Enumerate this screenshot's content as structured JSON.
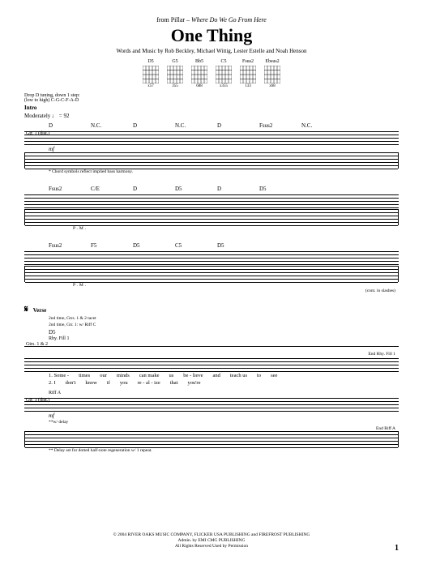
{
  "header": {
    "from_prefix": "from Pillar – ",
    "album": "Where Do We Go From Here",
    "title": "One Thing",
    "credits": "Words and Music by Rob Beckley, Michael Wittig, Lester Estelle and Noah Henson"
  },
  "chord_diagrams": [
    {
      "name": "D5",
      "fret": "x57"
    },
    {
      "name": "G5",
      "fret": "355"
    },
    {
      "name": "Bb5",
      "fret": "688"
    },
    {
      "name": "C5",
      "fret": "x355"
    },
    {
      "name": "Fsus2",
      "fret": "133"
    },
    {
      "name": "Ebsus2",
      "fret": "x68"
    }
  ],
  "tuning": {
    "line1": "Drop D tuning, down 1 step:",
    "line2": "(low to high) C-G-C-F-A-D"
  },
  "intro": {
    "section": "Intro",
    "tempo_label": "Moderately",
    "tempo_mark": "♩ = 92"
  },
  "gtr_labels": {
    "gtr1": "Gtr. 1 (dist.)",
    "gtr12": "Gtrs. 1 & 2",
    "gtr3": "Gtr. 3 (dist.)",
    "rhy_fill1": "Rhy. Fill 1",
    "riff_a": "Riff A",
    "end_rhy_fill1": "End Rhy. Fill 1",
    "end_riff_a": "End Riff A"
  },
  "dynamics": {
    "mf": "mf"
  },
  "system1": {
    "chords": [
      "D",
      "N.C.",
      "D",
      "N.C.",
      "D",
      "Fsus2",
      "N.C."
    ],
    "harmony_note": "* Chord symbols reflect implied bass harmony."
  },
  "system2": {
    "chords": [
      "Fsus2",
      "C/E",
      "D",
      "D5",
      "D",
      "D5"
    ],
    "pm": "P.M."
  },
  "system3": {
    "chords": [
      "Fsus2",
      "F5",
      "D5",
      "C5",
      "D5"
    ],
    "pm": "P.M.",
    "end_note": "(cont. in slashes)"
  },
  "verse": {
    "segno": "𝄋",
    "label": "Verse",
    "direction1": "2nd time, Gtrs. 1 & 2 tacet",
    "direction2": "2nd time, Gtr. 1: w/ Riff C",
    "chord": "D5",
    "lyrics_line1": [
      "1. Some -",
      "times",
      "our",
      "minds",
      "can make",
      "us",
      "be - lieve",
      "",
      "and",
      "teach us",
      "to",
      "see"
    ],
    "lyrics_line2": [
      "2. I",
      "don't",
      "know",
      "if",
      "you",
      "re - al - ize",
      "",
      "",
      "that",
      "you're"
    ],
    "delay_note": "**w/ delay",
    "delay_footnote": "** Delay set for dotted half-note regeneration w/ 1 repeat."
  },
  "copyright": {
    "line1": "© 2004 RIVER OAKS MUSIC COMPANY, FLICKER USA PUBLISHING and FIREFROST PUBLISHING",
    "line2": "Admin. by EMI CMG PUBLISHING",
    "line3": "All Rights Reserved   Used by Permission"
  },
  "page_number": "1"
}
